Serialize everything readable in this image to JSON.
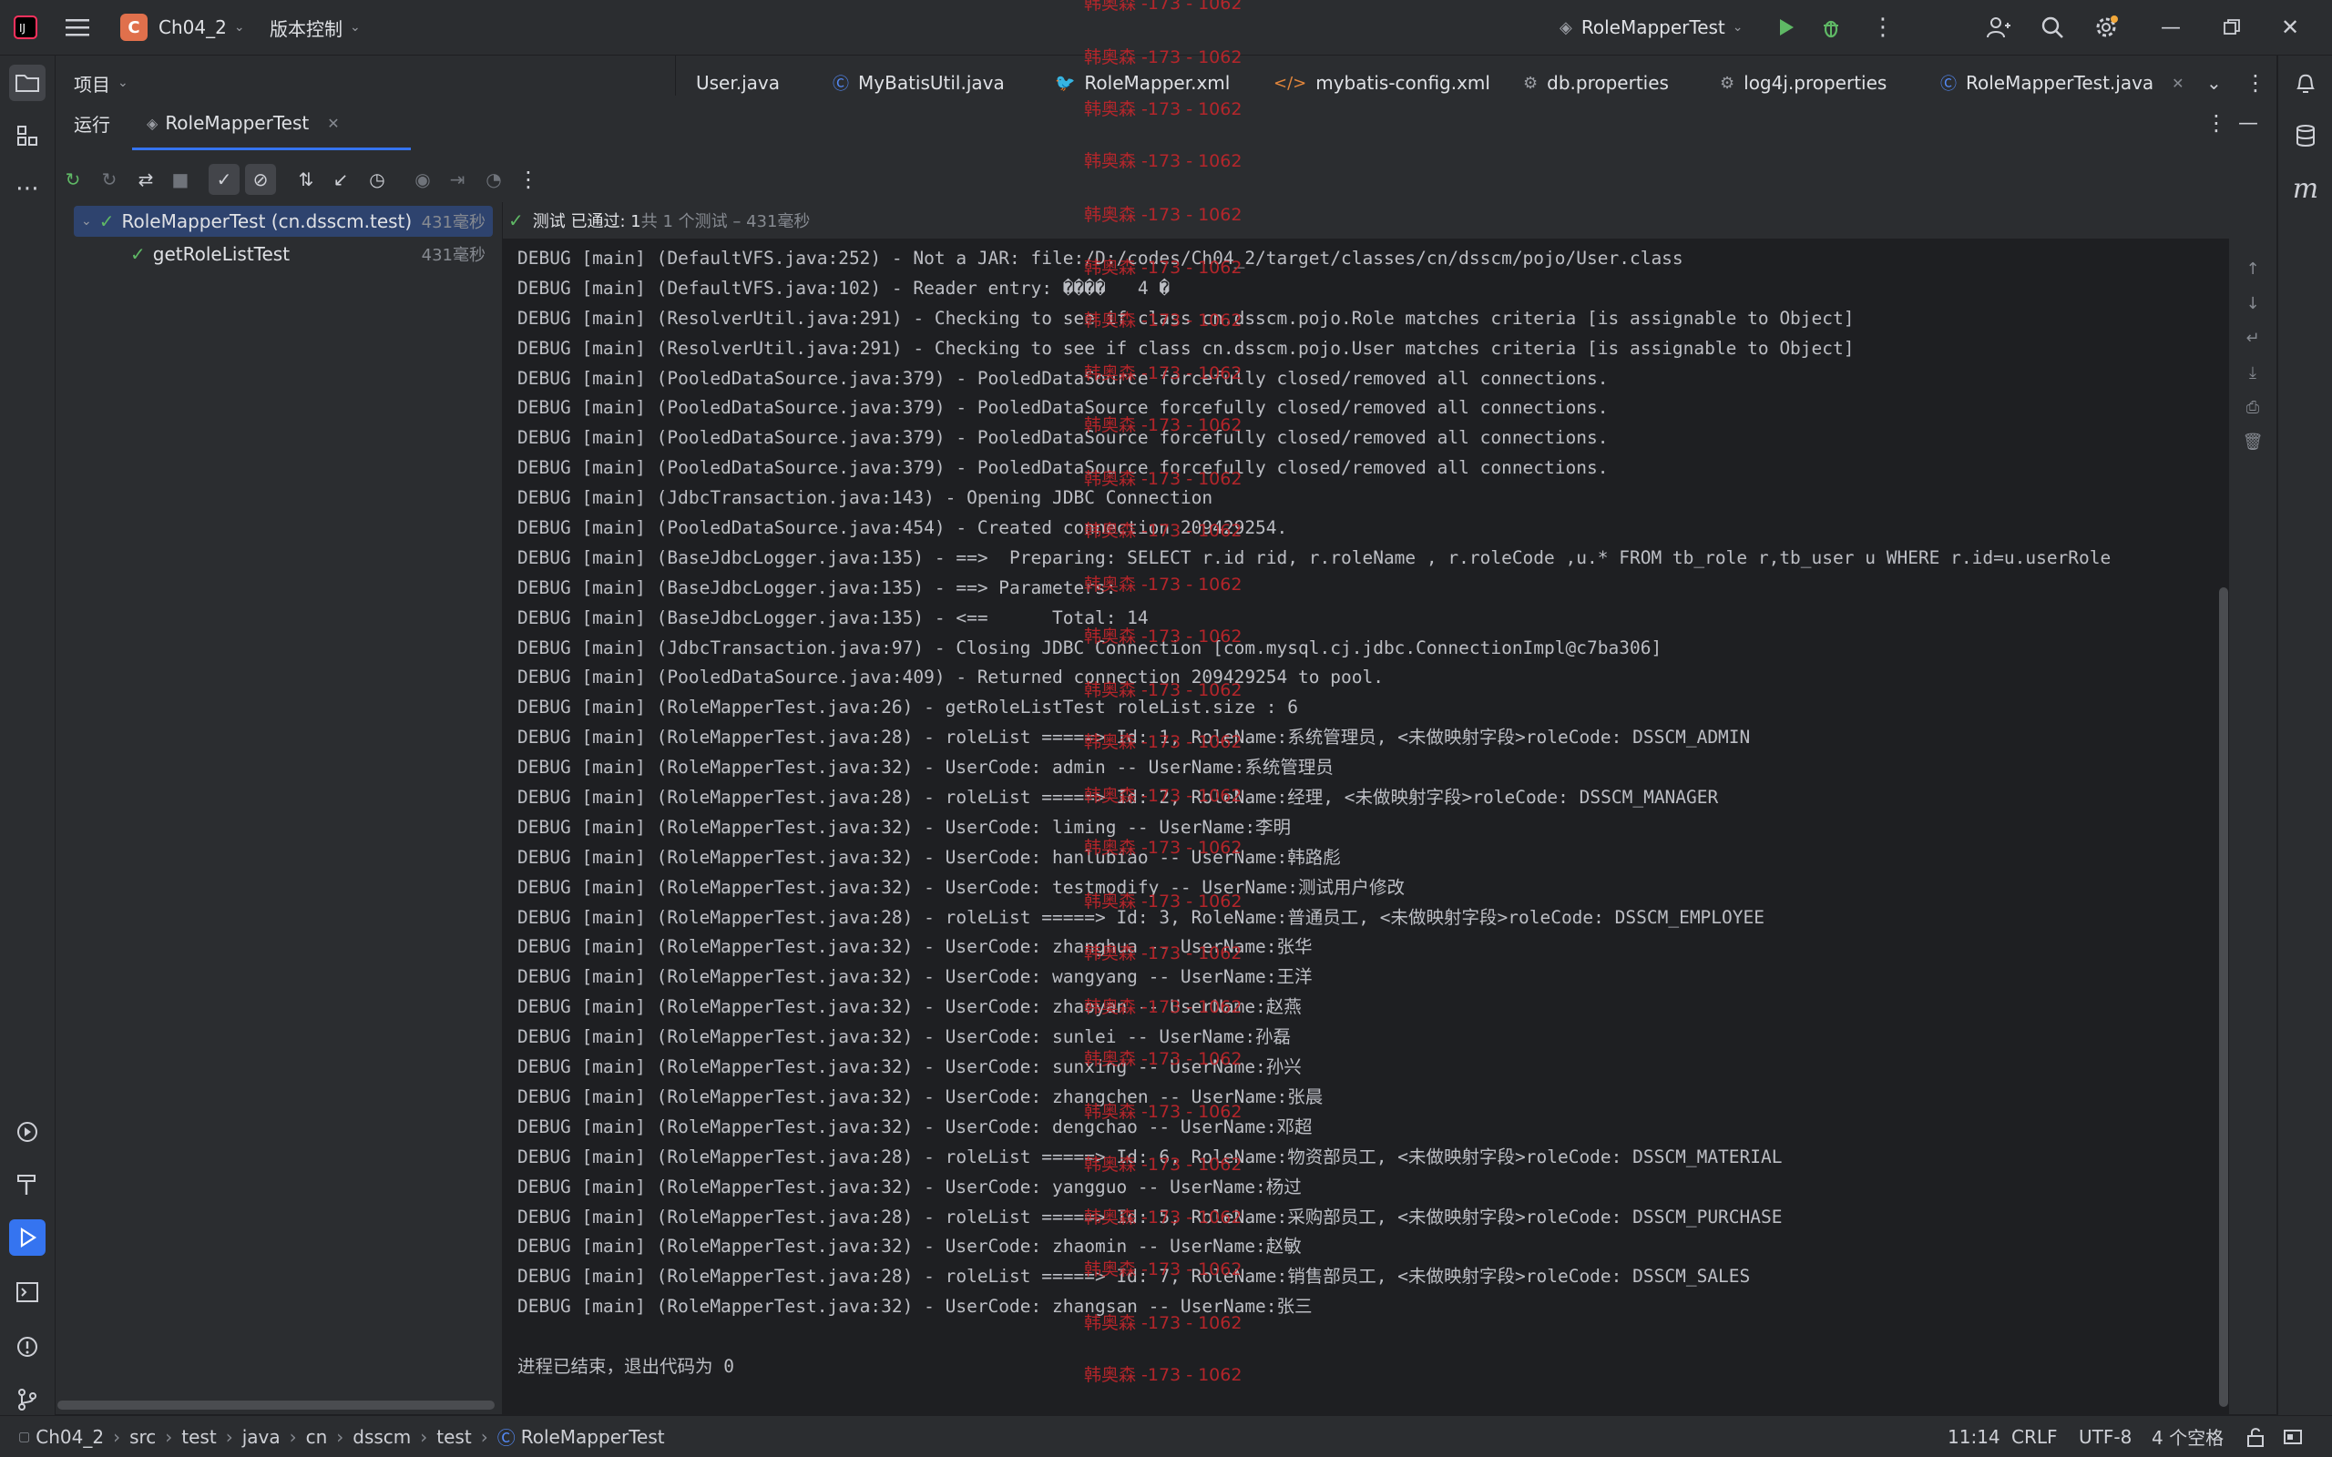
{
  "titlebar": {
    "project_badge": "C",
    "project_name": "Ch04_2",
    "vcs_menu": "版本控制",
    "run_config": "RoleMapperTest"
  },
  "editor_tabs": [
    {
      "label": "User.java",
      "icon": "java-file-icon"
    },
    {
      "label": "MyBatisUtil.java",
      "icon": "class-icon"
    },
    {
      "label": "RoleMapper.xml",
      "icon": "mybatis-xml-icon"
    },
    {
      "label": "mybatis-config.xml",
      "icon": "xml-icon"
    },
    {
      "label": "db.properties",
      "icon": "properties-icon"
    },
    {
      "label": "log4j.properties",
      "icon": "properties-icon"
    },
    {
      "label": "RoleMapperTest.java",
      "icon": "class-icon"
    }
  ],
  "project_panel": {
    "label": "项目"
  },
  "run_panel": {
    "tab_run": "运行",
    "tab_test": "RoleMapperTest"
  },
  "test_tree": {
    "root_label": "RoleMapperTest (cn.dsscm.test)",
    "root_time": "431毫秒",
    "child_label": "getRoleListTest",
    "child_time": "431毫秒"
  },
  "console": {
    "status_passed": "测试 已通过: 1",
    "status_detail": "共 1 个测试 – 431毫秒",
    "lines": [
      "DEBUG [main] (DefaultVFS.java:252) - Not a JAR: file:/D:/codes/Ch04_2/target/classes/cn/dsscm/pojo/User.class",
      "DEBUG [main] (DefaultVFS.java:102) - Reader entry: ����   4 �",
      "DEBUG [main] (ResolverUtil.java:291) - Checking to see if class cn.dsscm.pojo.Role matches criteria [is assignable to Object]",
      "DEBUG [main] (ResolverUtil.java:291) - Checking to see if class cn.dsscm.pojo.User matches criteria [is assignable to Object]",
      "DEBUG [main] (PooledDataSource.java:379) - PooledDataSource forcefully closed/removed all connections.",
      "DEBUG [main] (PooledDataSource.java:379) - PooledDataSource forcefully closed/removed all connections.",
      "DEBUG [main] (PooledDataSource.java:379) - PooledDataSource forcefully closed/removed all connections.",
      "DEBUG [main] (PooledDataSource.java:379) - PooledDataSource forcefully closed/removed all connections.",
      "DEBUG [main] (JdbcTransaction.java:143) - Opening JDBC Connection",
      "DEBUG [main] (PooledDataSource.java:454) - Created connection 209429254.",
      "DEBUG [main] (BaseJdbcLogger.java:135) - ==>  Preparing: SELECT r.id rid, r.roleName , r.roleCode ,u.* FROM tb_role r,tb_user u WHERE r.id=u.userRole",
      "DEBUG [main] (BaseJdbcLogger.java:135) - ==> Parameters: ",
      "DEBUG [main] (BaseJdbcLogger.java:135) - <==      Total: 14",
      "DEBUG [main] (JdbcTransaction.java:97) - Closing JDBC Connection [com.mysql.cj.jdbc.ConnectionImpl@c7ba306]",
      "DEBUG [main] (PooledDataSource.java:409) - Returned connection 209429254 to pool.",
      "DEBUG [main] (RoleMapperTest.java:26) - getRoleListTest roleList.size : 6",
      "DEBUG [main] (RoleMapperTest.java:28) - roleList =====> Id: 1, RoleName:系统管理员, <未做映射字段>roleCode: DSSCM_ADMIN",
      "DEBUG [main] (RoleMapperTest.java:32) - UserCode: admin -- UserName:系统管理员",
      "DEBUG [main] (RoleMapperTest.java:28) - roleList =====> Id: 2, RoleName:经理, <未做映射字段>roleCode: DSSCM_MANAGER",
      "DEBUG [main] (RoleMapperTest.java:32) - UserCode: liming -- UserName:李明",
      "DEBUG [main] (RoleMapperTest.java:32) - UserCode: hanlubiao -- UserName:韩路彪",
      "DEBUG [main] (RoleMapperTest.java:32) - UserCode: testmodify -- UserName:测试用户修改",
      "DEBUG [main] (RoleMapperTest.java:28) - roleList =====> Id: 3, RoleName:普通员工, <未做映射字段>roleCode: DSSCM_EMPLOYEE",
      "DEBUG [main] (RoleMapperTest.java:32) - UserCode: zhanghua -- UserName:张华",
      "DEBUG [main] (RoleMapperTest.java:32) - UserCode: wangyang -- UserName:王洋",
      "DEBUG [main] (RoleMapperTest.java:32) - UserCode: zhaoyan -- UserName:赵燕",
      "DEBUG [main] (RoleMapperTest.java:32) - UserCode: sunlei -- UserName:孙磊",
      "DEBUG [main] (RoleMapperTest.java:32) - UserCode: sunxing -- UserName:孙兴",
      "DEBUG [main] (RoleMapperTest.java:32) - UserCode: zhangchen -- UserName:张晨",
      "DEBUG [main] (RoleMapperTest.java:32) - UserCode: dengchao -- UserName:邓超",
      "DEBUG [main] (RoleMapperTest.java:28) - roleList =====> Id: 6, RoleName:物资部员工, <未做映射字段>roleCode: DSSCM_MATERIAL",
      "DEBUG [main] (RoleMapperTest.java:32) - UserCode: yangguo -- UserName:杨过",
      "DEBUG [main] (RoleMapperTest.java:28) - roleList =====> Id: 5, RoleName:采购部员工, <未做映射字段>roleCode: DSSCM_PURCHASE",
      "DEBUG [main] (RoleMapperTest.java:32) - UserCode: zhaomin -- UserName:赵敏",
      "DEBUG [main] (RoleMapperTest.java:28) - roleList =====> Id: 7, RoleName:销售部员工, <未做映射字段>roleCode: DSSCM_SALES",
      "DEBUG [main] (RoleMapperTest.java:32) - UserCode: zhangsan -- UserName:张三",
      "",
      "进程已结束，退出代码为 0"
    ]
  },
  "watermark": "韩奥森 -173 - 1062",
  "statusbar": {
    "breadcrumbs": [
      "Ch04_2",
      "src",
      "test",
      "java",
      "cn",
      "dsscm",
      "test",
      "RoleMapperTest"
    ],
    "position": "11:14",
    "line_sep": "CRLF",
    "encoding": "UTF-8",
    "indent": "4 个空格"
  },
  "colors": {
    "accent": "#3574f0",
    "pass_green": "#5fb865",
    "watermark_red": "#c0262b"
  }
}
